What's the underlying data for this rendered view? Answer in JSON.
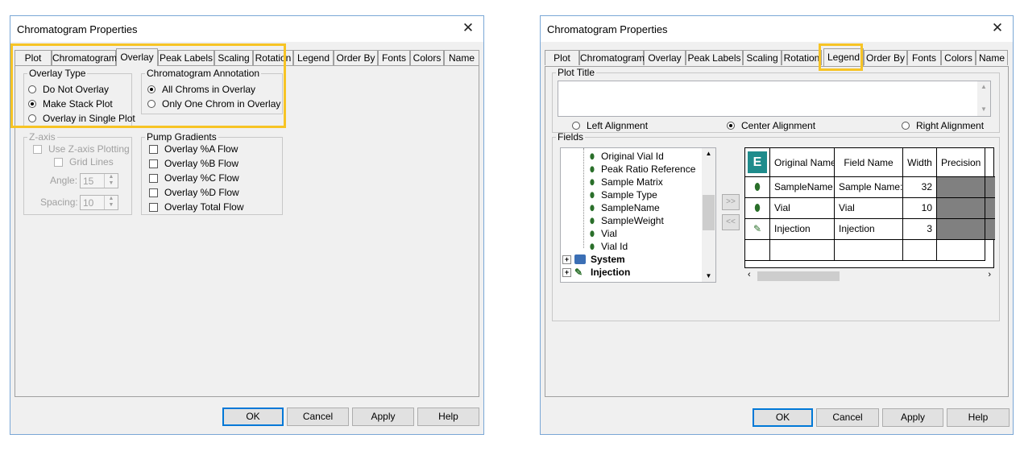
{
  "left": {
    "title": "Chromatogram Properties",
    "tabs": [
      "Plot",
      "Chromatogram",
      "Overlay",
      "Peak Labels",
      "Scaling",
      "Rotation",
      "Legend",
      "Order By",
      "Fonts",
      "Colors",
      "Name"
    ],
    "overlay_type": {
      "legend": "Overlay Type",
      "options": [
        "Do Not Overlay",
        "Make Stack Plot",
        "Overlay in Single Plot"
      ]
    },
    "annotation": {
      "legend": "Chromatogram Annotation",
      "options": [
        "All Chroms in Overlay",
        "Only One Chrom in Overlay"
      ]
    },
    "zaxis": {
      "legend": "Z-axis",
      "use_label": "Use Z-axis Plotting",
      "grid_label": "Grid Lines",
      "angle_label": "Angle:",
      "angle_value": "15",
      "spacing_label": "Spacing:",
      "spacing_value": "10"
    },
    "pump": {
      "legend": "Pump Gradients",
      "options": [
        "Overlay %A Flow",
        "Overlay %B Flow",
        "Overlay %C Flow",
        "Overlay %D Flow",
        "Overlay Total Flow"
      ]
    },
    "buttons": {
      "ok": "OK",
      "cancel": "Cancel",
      "apply": "Apply",
      "help": "Help"
    }
  },
  "right": {
    "title": "Chromatogram Properties",
    "tabs": [
      "Plot",
      "Chromatogram",
      "Overlay",
      "Peak Labels",
      "Scaling",
      "Rotation",
      "Legend",
      "Order By",
      "Fonts",
      "Colors",
      "Name"
    ],
    "plot_title": {
      "legend": "Plot Title",
      "left_align": "Left Alignment",
      "center_align": "Center Alignment",
      "right_align": "Right Alignment"
    },
    "fields": {
      "legend": "Fields",
      "tree": [
        "Original Vial Id",
        "Peak Ratio Reference",
        "Sample Matrix",
        "Sample Type",
        "SampleName",
        "SampleWeight",
        "Vial",
        "Vial Id"
      ],
      "tree_groups": [
        "System",
        "Injection"
      ],
      "grid_headers": [
        "Original Name",
        "Field Name",
        "Width",
        "Precision"
      ],
      "grid_rows": [
        {
          "original": "SampleName",
          "field": "Sample Name:",
          "width": "32"
        },
        {
          "original": "Vial",
          "field": "Vial",
          "width": "10"
        },
        {
          "original": "Injection",
          "field": "Injection",
          "width": "3"
        }
      ],
      "add_label": ">>",
      "remove_label": "<<"
    },
    "buttons": {
      "ok": "OK",
      "cancel": "Cancel",
      "apply": "Apply",
      "help": "Help"
    }
  },
  "colors": {
    "highlight": "#f7c425",
    "border": "#7aa7d6"
  }
}
